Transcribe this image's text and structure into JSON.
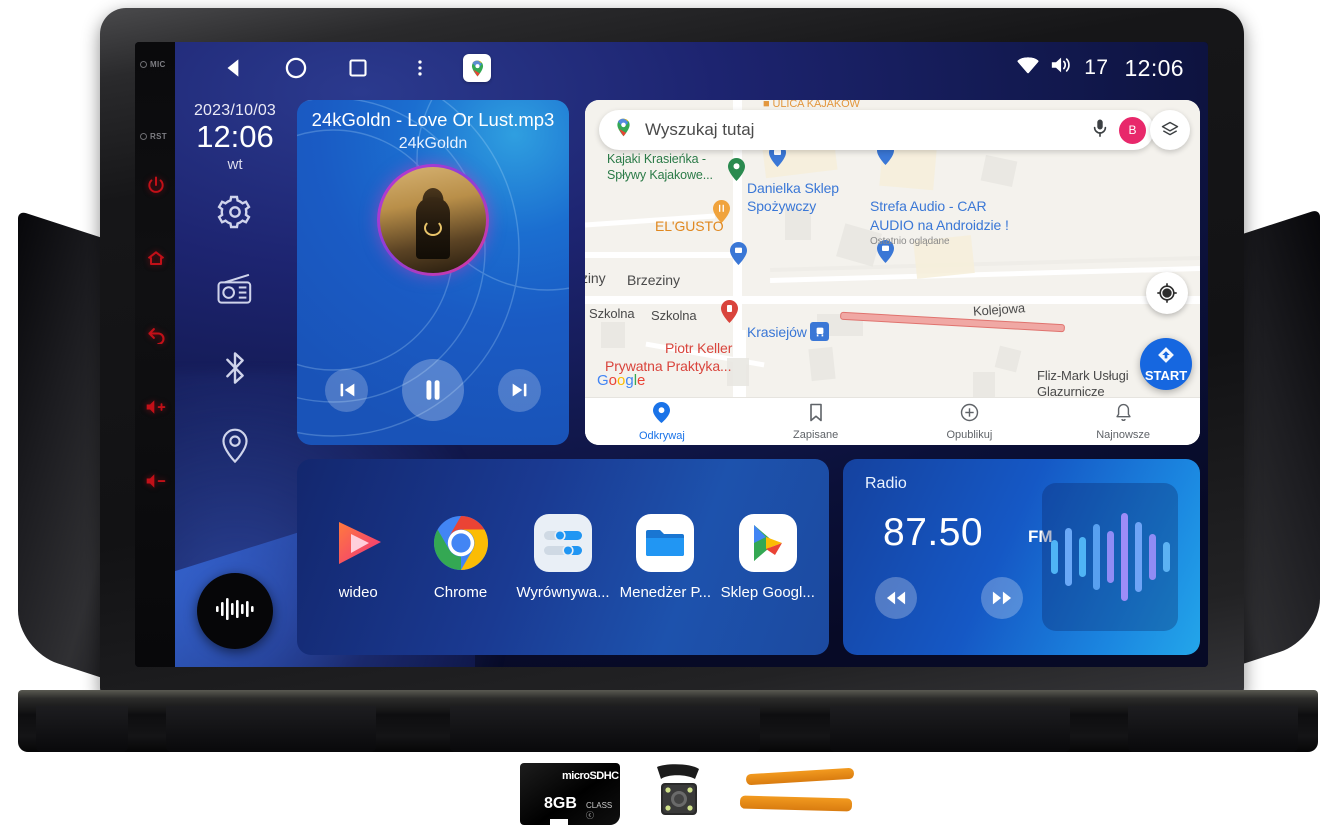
{
  "statusbar": {
    "back_icon": "back-triangle-icon",
    "home_icon": "home-circle-icon",
    "recents_icon": "recents-square-icon",
    "more_icon": "more-vertical-icon",
    "maps_shortcut_icon": "google-maps-icon",
    "wifi_icon": "wifi-icon",
    "volume_icon": "volume-icon",
    "volume_level": "17",
    "clock": "12:06"
  },
  "dock": {
    "date": "2023/10/03",
    "time": "12:06",
    "weekday": "wt",
    "icons": [
      {
        "name": "settings-gear-icon"
      },
      {
        "name": "radio-icon"
      },
      {
        "name": "bluetooth-icon"
      },
      {
        "name": "location-pin-icon"
      }
    ],
    "music_widget_icon": "waveform-icon"
  },
  "music": {
    "title": "24kGoldn - Love Or Lust.mp3",
    "artist": "24kGoldn",
    "prev_icon": "skip-previous-icon",
    "play_pause_icon": "pause-icon",
    "next_icon": "skip-next-icon"
  },
  "map": {
    "search_placeholder": "Wyszukaj tutaj",
    "search_pin_icon": "google-maps-pin-icon",
    "mic_icon": "microphone-icon",
    "avatar_initial": "B",
    "layers_icon": "map-layers-icon",
    "my_location_icon": "my-location-icon",
    "start_label": "START",
    "start_icon": "navigation-arrow-icon",
    "watermark": "Google",
    "labels": [
      {
        "text": "Kajaki Krasieńka -",
        "color": "green"
      },
      {
        "text": "Spływy Kajakowe...",
        "color": "green"
      },
      {
        "text": "Danielka Sklep",
        "color": "blue"
      },
      {
        "text": "Spożywczy",
        "color": "blue"
      },
      {
        "text": "EL'GUSTO",
        "color": "orange"
      },
      {
        "text": "Strefa Audio - CAR",
        "color": "blue"
      },
      {
        "text": "AUDIO na Androidzie !",
        "color": "blue"
      },
      {
        "text": "Ostatnio oglądane",
        "color": "sub"
      },
      {
        "text": "ziny",
        "color": "dark"
      },
      {
        "text": "Brzeziny",
        "color": "dark"
      },
      {
        "text": "Szkolna",
        "color": "dark"
      },
      {
        "text": "Szkolna",
        "color": "dark"
      },
      {
        "text": "Kolejowa",
        "color": "dark"
      },
      {
        "text": "Krasiejów",
        "color": "blue"
      },
      {
        "text": "Piotr Keller",
        "color": "red"
      },
      {
        "text": "Prywatna Praktyka...",
        "color": "red"
      },
      {
        "text": "Fliz-Mark Usługi",
        "color": "dark"
      },
      {
        "text": "Glazurnicze",
        "color": "dark"
      }
    ],
    "bottom_nav": [
      {
        "label": "Odkrywaj",
        "icon": "explore-pin-icon",
        "active": true
      },
      {
        "label": "Zapisane",
        "icon": "bookmark-icon",
        "active": false
      },
      {
        "label": "Opublikuj",
        "icon": "plus-circle-icon",
        "active": false
      },
      {
        "label": "Najnowsze",
        "icon": "bell-icon",
        "active": false
      }
    ]
  },
  "apps": [
    {
      "label": "wideo",
      "icon": "video-player-icon"
    },
    {
      "label": "Chrome",
      "icon": "chrome-icon"
    },
    {
      "label": "Wyrównywa...",
      "icon": "equalizer-icon"
    },
    {
      "label": "Menedżer P...",
      "icon": "file-manager-icon"
    },
    {
      "label": "Sklep Googl...",
      "icon": "google-play-icon"
    }
  ],
  "radio": {
    "title": "Radio",
    "frequency": "87.50",
    "band": "FM",
    "prev_icon": "rewind-icon",
    "next_icon": "fast-forward-icon",
    "visualizer_icon": "audio-waveform-icon",
    "visualizer_bars": [
      34,
      58,
      40,
      66,
      52,
      88,
      70,
      46,
      30
    ]
  },
  "hardware_keys": {
    "leds": [
      {
        "label": "MIC"
      },
      {
        "label": "RST"
      }
    ],
    "buttons": [
      {
        "name": "power-button-icon"
      },
      {
        "name": "home-button-icon"
      },
      {
        "name": "back-button-icon"
      },
      {
        "name": "volume-up-button-icon"
      },
      {
        "name": "volume-down-button-icon"
      }
    ]
  },
  "accessories": [
    {
      "name": "microsd-card",
      "capacity": "8GB",
      "logo": "microSDHC"
    },
    {
      "name": "rear-view-camera"
    },
    {
      "name": "pry-tools"
    }
  ],
  "colors": {
    "accent_blue": "#1667e0",
    "screen_bg": "#131a52",
    "card_blue": "#1b6ed0",
    "radio_blue": "#1558c5",
    "key_red": "#c21018",
    "avatar_pink": "#e8286b"
  }
}
